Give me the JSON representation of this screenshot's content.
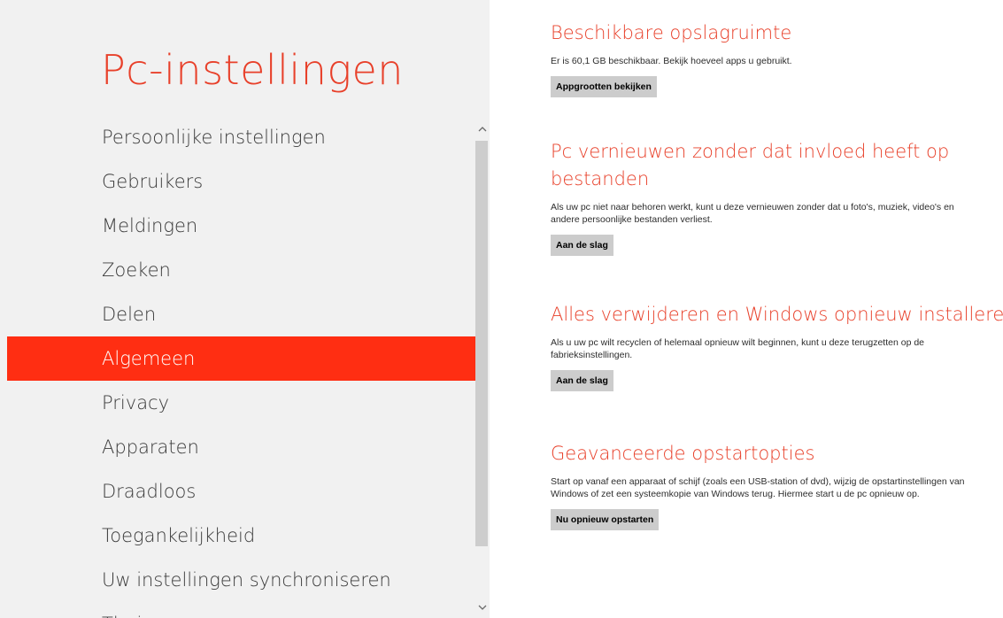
{
  "nav": {
    "title": "Pc-instellingen",
    "items": [
      {
        "label": "Persoonlijke instellingen"
      },
      {
        "label": "Gebruikers"
      },
      {
        "label": "Meldingen"
      },
      {
        "label": "Zoeken"
      },
      {
        "label": "Delen"
      },
      {
        "label": "Algemeen",
        "selected": true
      },
      {
        "label": "Privacy"
      },
      {
        "label": "Apparaten"
      },
      {
        "label": "Draadloos"
      },
      {
        "label": "Toegankelijkheid"
      },
      {
        "label": "Uw instellingen synchroniseren"
      },
      {
        "label": "Thuisgroep"
      }
    ]
  },
  "scrollbar": {
    "up_icon": "chevron-up-icon",
    "down_icon": "chevron-down-icon"
  },
  "sections": {
    "storage": {
      "title": "Beschikbare opslagruimte",
      "description": "Er is 60,1 GB beschikbaar. Bekijk hoeveel apps u gebruikt.",
      "button": "Appgrootten bekijken"
    },
    "refresh": {
      "title_line1": "Pc vernieuwen zonder dat invloed heeft op",
      "title_line2": "bestanden",
      "description": "Als uw pc niet naar behoren werkt, kunt u deze vernieuwen zonder dat u foto's, muziek, video's en andere persoonlijke bestanden verliest.",
      "button": "Aan de slag"
    },
    "reset": {
      "title": "Alles verwijderen en Windows opnieuw installeren",
      "description": "Als u uw pc wilt recyclen of helemaal opnieuw wilt beginnen, kunt u deze terugzetten op de fabrieksinstellingen.",
      "button": "Aan de slag"
    },
    "advanced": {
      "title": "Geavanceerde opstartopties",
      "description": "Start op vanaf een apparaat of schijf (zoals een USB-station of dvd), wijzig de opstartinstellingen van Windows of zet een systeemkopie van Windows terug. Hiermee start u de pc opnieuw op.",
      "button": "Nu opnieuw opstarten"
    }
  },
  "colors": {
    "accent": "#e8402a",
    "selected_bg": "#ff2e12",
    "nav_bg": "#f1f1f1",
    "button_bg": "#cccccc"
  }
}
